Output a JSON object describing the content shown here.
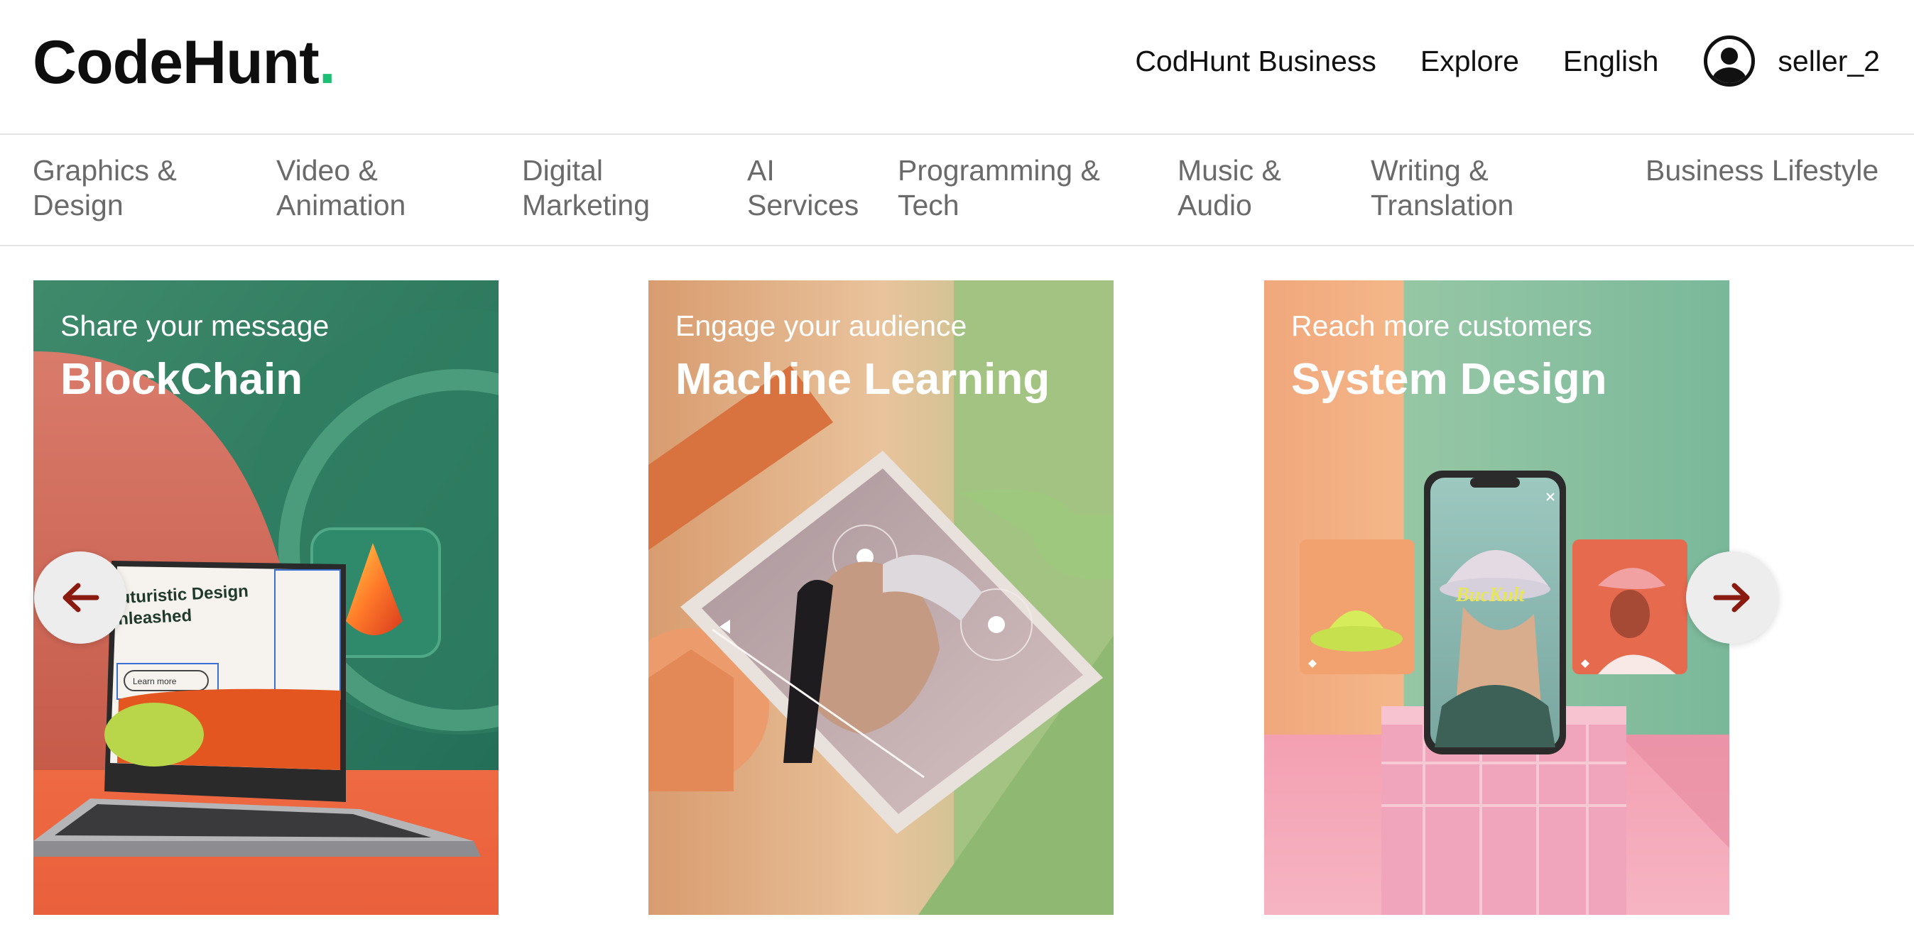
{
  "header": {
    "logo": {
      "text": "CodeHunt",
      "dot": "."
    },
    "nav": {
      "business": "CodHunt Business",
      "explore": "Explore",
      "language": "English"
    },
    "user": {
      "name": "seller_2"
    }
  },
  "categories": [
    "Graphics &\nDesign",
    "Video &\nAnimation",
    "Digital\nMarketing",
    "AI\nServices",
    "Programming &\nTech",
    "Music &\nAudio",
    "Writing &\nTranslation",
    "Business Lifestyle"
  ],
  "carousel": {
    "cards": [
      {
        "subtitle": "Share your message",
        "title": "BlockChain",
        "art_text": "uturistic Design\nnleashed",
        "art_button": "Learn more"
      },
      {
        "subtitle": "Engage your audience",
        "title": "Machine Learning"
      },
      {
        "subtitle": "Reach more customers",
        "title": "System Design",
        "art_text": "BucKult"
      }
    ],
    "prev_icon": "arrow-left-icon",
    "next_icon": "arrow-right-icon"
  },
  "colors": {
    "brand_dot": "#1dbf73",
    "arrow": "#8b1a10",
    "category_text": "#6a6a6a"
  }
}
